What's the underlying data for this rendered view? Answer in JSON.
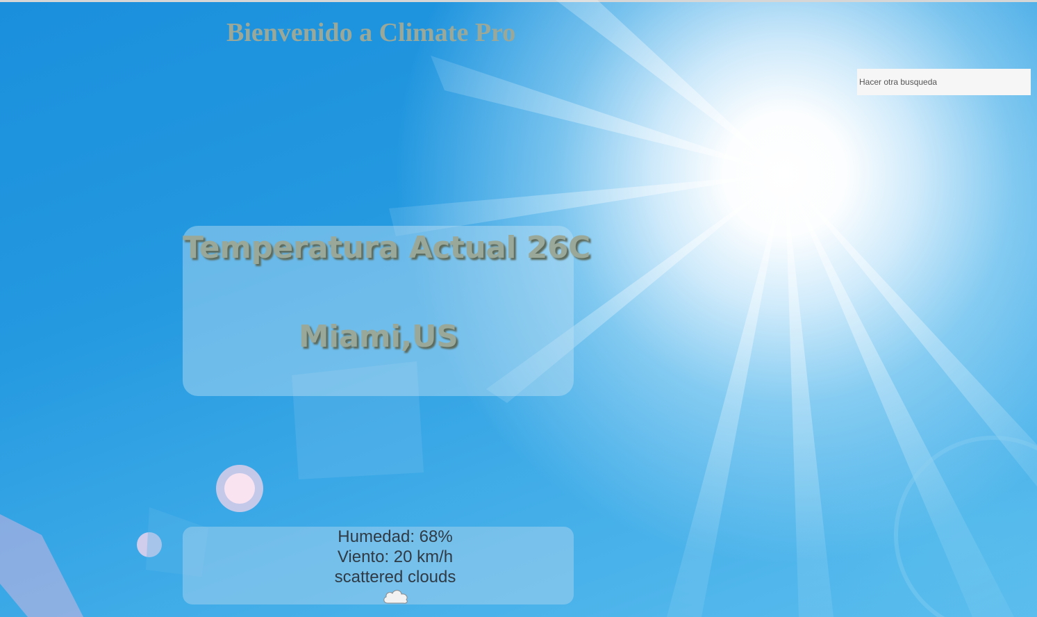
{
  "header": {
    "title": "Bienvenido a Climate Pro"
  },
  "search": {
    "placeholder": "Hacer otra busqueda"
  },
  "current": {
    "temperature_line": "Temperatura Actual 26C",
    "location": "Miami,US"
  },
  "details": {
    "humidity": "Humedad: 68%",
    "wind": "Viento: 20 km/h",
    "description": "scattered clouds",
    "icon": "cloud-icon"
  },
  "colors": {
    "title_text": "#9aa89a",
    "sky_blue": "#1a8fdc",
    "detail_text": "#2f3a44"
  }
}
